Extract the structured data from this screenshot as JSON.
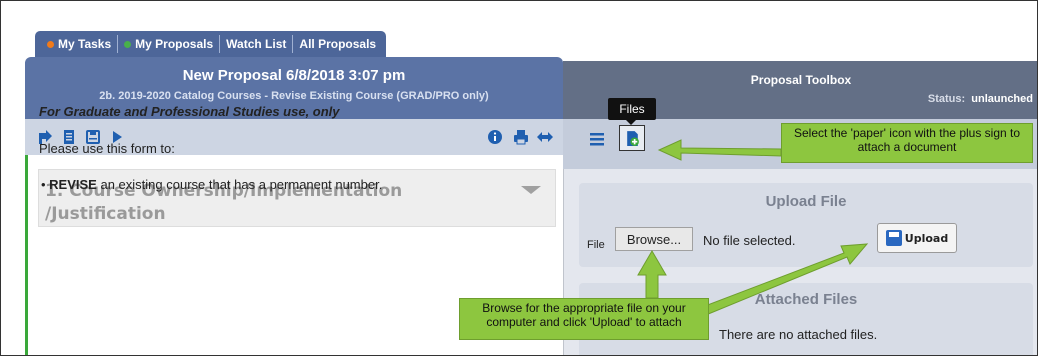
{
  "tabs": [
    {
      "label": "My Tasks",
      "dot": "#f07a1a"
    },
    {
      "label": "My Proposals",
      "dot": "#48b04a"
    },
    {
      "label": "Watch List"
    },
    {
      "label": "All Proposals"
    }
  ],
  "proposal": {
    "title": "New Proposal 6/8/2018 3:07 pm",
    "subtitle": "2b. 2019-2020 Catalog Courses - Revise Existing Course (GRAD/PRO only)"
  },
  "left_toolbar": {
    "icons": [
      "arrow-jump-icon",
      "document-icon",
      "save-icon",
      "play-icon",
      "info-icon",
      "print-icon",
      "expand-icon"
    ]
  },
  "section": {
    "title_line1": "1. Course Ownership/Implementation",
    "title_line2": "/Justification",
    "grad_use": "For Graduate and Professional Studies use, only",
    "please": "Please use this form to:",
    "bullet_bold": "REVISE",
    "bullet_rest": " an existing course that has a permanent number."
  },
  "toolbox": {
    "title": "Proposal Toolbox",
    "status_label": "Status:",
    "status_value": "unlaunched",
    "tooltip": "Files"
  },
  "upload": {
    "title": "Upload File",
    "file_label": "File",
    "browse_label": "Browse...",
    "no_file": "No file selected.",
    "upload_label": "Upload"
  },
  "attached": {
    "title": "Attached Files",
    "empty": "There are no attached files."
  },
  "callouts": {
    "paper_icon": "Select the 'paper' icon with the plus sign to attach a document",
    "browse": "Browse for the appropriate file on your computer and click 'Upload' to attach"
  },
  "colors": {
    "callout": "#8dc63f",
    "tab_bar": "#4d6699",
    "accent_green": "#3aa83a"
  }
}
